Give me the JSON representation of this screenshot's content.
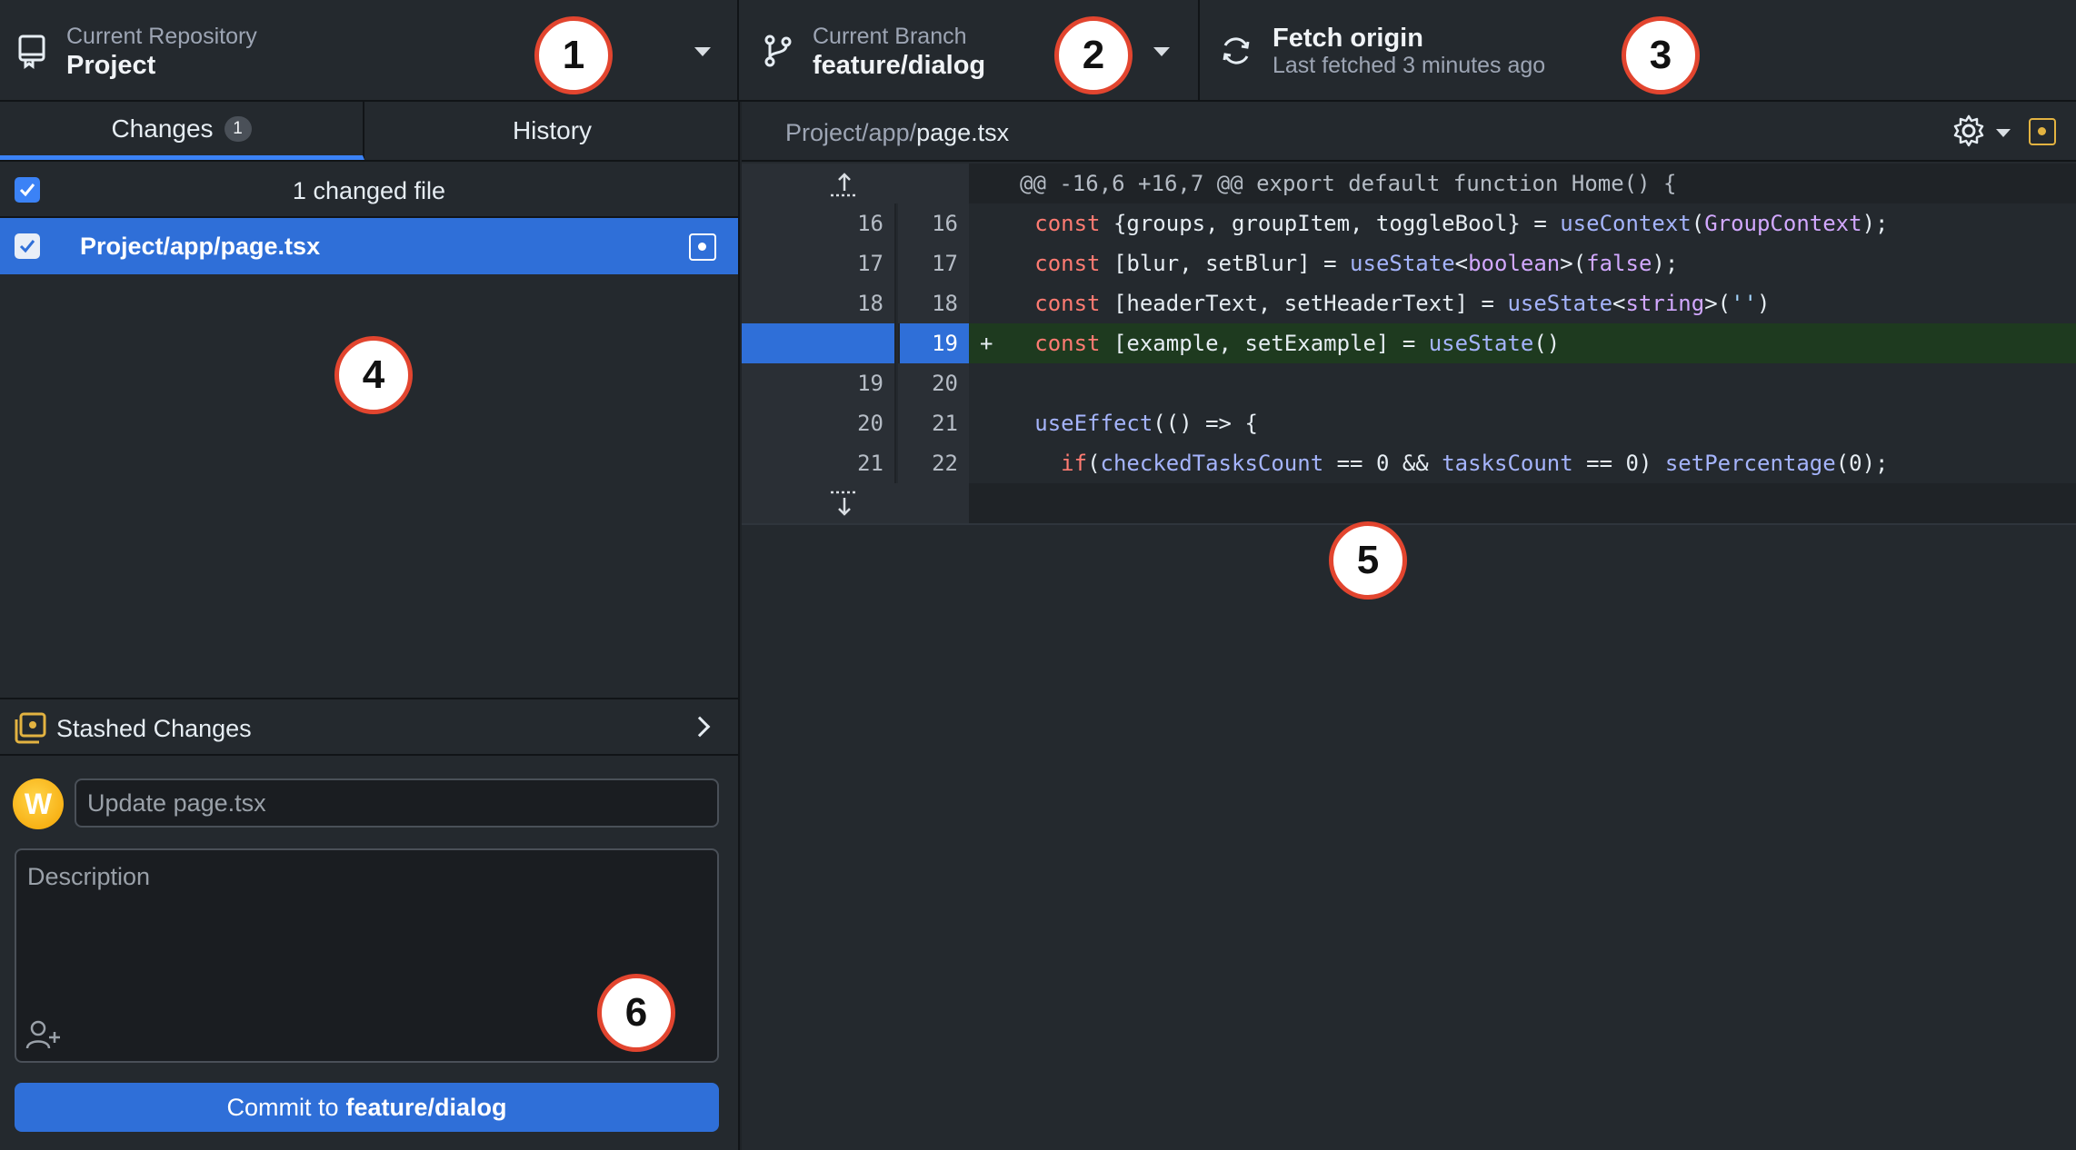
{
  "toolbar": {
    "repo": {
      "sub": "Current Repository",
      "main": "Project"
    },
    "branch": {
      "sub": "Current Branch",
      "main": "feature/dialog"
    },
    "fetch": {
      "main": "Fetch origin",
      "sub": "Last fetched 3 minutes ago"
    }
  },
  "tabs": {
    "changes": "Changes",
    "changes_count": "1",
    "history": "History"
  },
  "changes": {
    "summary": "1 changed file",
    "files": [
      {
        "path": "Project/app/page.tsx"
      }
    ]
  },
  "stash": {
    "label": "Stashed Changes"
  },
  "commit": {
    "avatar_letter": "W",
    "summary_placeholder": "Update page.tsx",
    "description_placeholder": "Description",
    "button_prefix": "Commit to",
    "button_branch": "feature/dialog"
  },
  "diff": {
    "path_dir": "Project/app/",
    "path_file": "page.tsx",
    "hunk_header": "@@ -16,6 +16,7 @@ export default function Home() {",
    "lines": [
      {
        "old": "16",
        "new": "16",
        "marker": ""
      },
      {
        "old": "17",
        "new": "17",
        "marker": ""
      },
      {
        "old": "18",
        "new": "18",
        "marker": ""
      },
      {
        "old": "",
        "new": "19",
        "marker": "+"
      },
      {
        "old": "19",
        "new": "20",
        "marker": ""
      },
      {
        "old": "20",
        "new": "21",
        "marker": ""
      },
      {
        "old": "21",
        "new": "22",
        "marker": ""
      }
    ]
  },
  "callouts": [
    "1",
    "2",
    "3",
    "4",
    "5",
    "6"
  ],
  "colors": {
    "accent": "#2f6fd8",
    "added_bg": "#1e3a1f",
    "callout_border": "#e2452f",
    "modified": "#e3b341"
  },
  "icons": [
    "repo-icon",
    "branch-icon",
    "sync-icon",
    "caret-down-icon",
    "check-icon",
    "modified-file-icon",
    "stash-icon",
    "chevron-right-icon",
    "gear-icon",
    "add-coauthor-icon",
    "expand-up-icon",
    "expand-down-icon"
  ]
}
